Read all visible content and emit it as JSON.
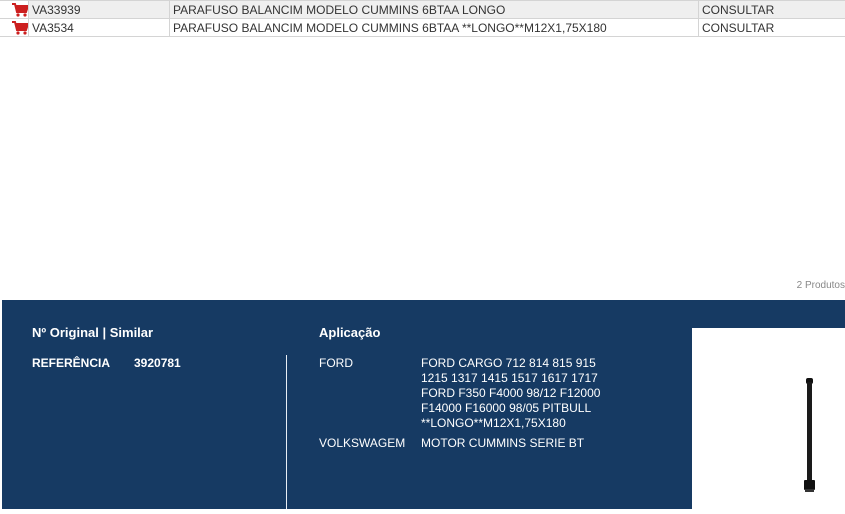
{
  "products": [
    {
      "code": "VA33939",
      "description": "PARAFUSO BALANCIM MODELO CUMMINS 6BTAA LONGO",
      "status": "CONSULTAR",
      "icon": "shopping-cart-icon"
    },
    {
      "code": "VA3534",
      "description": "PARAFUSO BALANCIM MODELO CUMMINS 6BTAA **LONGO**M12X1,75X180",
      "status": "CONSULTAR",
      "icon": "shopping-cart-icon"
    }
  ],
  "product_count": "2 Produtos",
  "detail": {
    "original_heading": "Nº Original | Similar",
    "application_heading": "Aplicação",
    "reference_label": "REFERÊNCIA",
    "reference_value": "3920781",
    "applications": [
      {
        "brand": "FORD",
        "detail": "FORD CARGO 712 814 815 915 1215 1317 1415 1517 1617 1717 FORD F350 F4000 98/12 F12000 F14000 F16000 98/05 PITBULL **LONGO**M12X1,75X180"
      },
      {
        "brand": "VOLKSWAGEM",
        "detail": "MOTOR CUMMINS SERIE BT"
      }
    ]
  },
  "colors": {
    "panel_bg": "#163a63",
    "cart_icon": "#cc1f1f",
    "row_alt_bg": "#efefef"
  }
}
